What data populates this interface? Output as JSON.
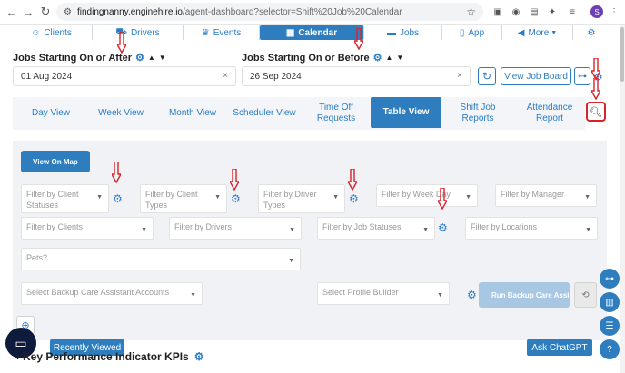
{
  "browser": {
    "url_host": "findingnanny.enginehire.io",
    "url_path": "/agent-dashboard?selector=Shift%20Job%20Calendar",
    "profile_letter": "S"
  },
  "menu": {
    "items": [
      {
        "label": "Clients",
        "icon": "users-icon"
      },
      {
        "label": "Drivers",
        "icon": "car-icon"
      },
      {
        "label": "Events",
        "icon": "trophy-icon"
      },
      {
        "label": "Calendar",
        "icon": "calendar-icon"
      },
      {
        "label": "Jobs",
        "icon": "briefcase-icon"
      },
      {
        "label": "App",
        "icon": "mobile-icon"
      },
      {
        "label": "More",
        "icon": "megaphone-icon"
      }
    ]
  },
  "dates": {
    "after_label": "Jobs Starting On or After",
    "after_value": "01 Aug 2024",
    "before_label": "Jobs Starting On or Before",
    "before_value": "26 Sep 2024"
  },
  "actions": {
    "view_job_board": "View Job Board"
  },
  "tabs": [
    {
      "label": "Day View"
    },
    {
      "label": "Week View"
    },
    {
      "label": "Month View"
    },
    {
      "label": "Scheduler View"
    },
    {
      "label": "Time Off Requests"
    },
    {
      "label": "Table View"
    },
    {
      "label": "Shift Job Reports"
    },
    {
      "label": "Attendance Report"
    }
  ],
  "filters": {
    "map_button": "View On Map",
    "client_statuses": "Filter by Client Statuses",
    "client_types": "Filter by Client Types",
    "driver_types": "Filter by Driver Types",
    "week_day": "Filter by Week Day",
    "manager": "Filter by Manager",
    "clients": "Filter by Clients",
    "drivers": "Filter by Drivers",
    "job_statuses": "Filter by Job Statuses",
    "locations": "Filter by Locations",
    "pets": "Pets?",
    "backup_care": "Select Backup Care Assistant Accounts",
    "profile_builder": "Select Profile Builder",
    "run_button": "Run Backup Care Assista"
  },
  "bottom": {
    "recently_viewed": "Recently Viewed",
    "kpi_title": "Key Performance Indicator KPIs",
    "ask_chatgpt": "Ask ChatGPT"
  },
  "colors": {
    "primary": "#2e7dbf",
    "annotation_red": "#d9232a"
  }
}
